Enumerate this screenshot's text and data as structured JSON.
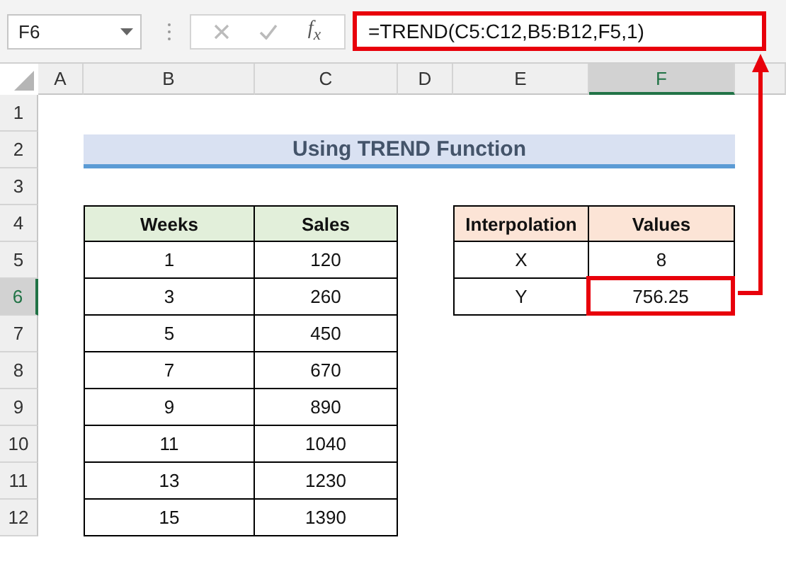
{
  "name_box": {
    "value": "F6"
  },
  "formula_bar": {
    "function_label": "f$_{x}$",
    "formula": "=TREND(C5:C12,B5:B12,F5,1)"
  },
  "columns": [
    {
      "label": "A",
      "selected": false
    },
    {
      "label": "B",
      "selected": false
    },
    {
      "label": "C",
      "selected": false
    },
    {
      "label": "D",
      "selected": false
    },
    {
      "label": "E",
      "selected": false
    },
    {
      "label": "F",
      "selected": true
    }
  ],
  "rows": [
    {
      "label": "1",
      "selected": false
    },
    {
      "label": "2",
      "selected": false
    },
    {
      "label": "3",
      "selected": false
    },
    {
      "label": "4",
      "selected": false
    },
    {
      "label": "5",
      "selected": false
    },
    {
      "label": "6",
      "selected": true
    },
    {
      "label": "7",
      "selected": false
    },
    {
      "label": "8",
      "selected": false
    },
    {
      "label": "9",
      "selected": false
    },
    {
      "label": "10",
      "selected": false
    },
    {
      "label": "11",
      "selected": false
    },
    {
      "label": "12",
      "selected": false
    }
  ],
  "title": "Using TREND Function",
  "data_table": {
    "columns": [
      "Weeks",
      "Sales"
    ],
    "rows": [
      [
        "1",
        "120"
      ],
      [
        "3",
        "260"
      ],
      [
        "5",
        "450"
      ],
      [
        "7",
        "670"
      ],
      [
        "9",
        "890"
      ],
      [
        "11",
        "1040"
      ],
      [
        "13",
        "1230"
      ],
      [
        "15",
        "1390"
      ]
    ]
  },
  "interpolation_table": {
    "columns": [
      "Interpolation",
      "Values"
    ],
    "rows": [
      {
        "label": "X",
        "value": "8",
        "selected": false
      },
      {
        "label": "Y",
        "value": "756.25",
        "selected": true
      }
    ]
  }
}
